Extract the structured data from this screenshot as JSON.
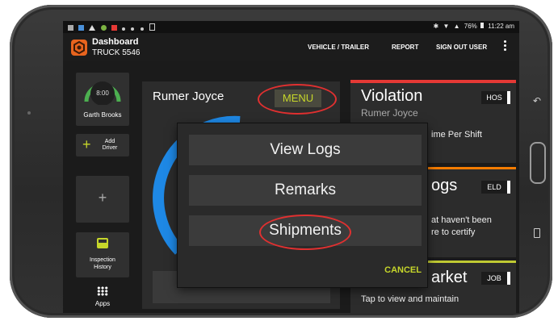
{
  "status_bar": {
    "battery": "76%",
    "time": "11:22 am"
  },
  "app_bar": {
    "title": "Dashboard",
    "subtitle": "TRUCK 5546",
    "nav": [
      "VEHICLE / TRAILER",
      "REPORT",
      "SIGN OUT USER"
    ],
    "overflow_icon": "more-vert-icon"
  },
  "sidebar": {
    "driver_time": "8:00",
    "driver_name": "Garth Brooks",
    "add_driver_label": "Add Driver",
    "plus_symbol": "+",
    "inspection_label": "Inspection History",
    "apps_label": "Apps"
  },
  "driver_card": {
    "name": "Rumer Joyce",
    "menu_label": "MENU"
  },
  "right_cards": {
    "violation": {
      "title": "Violation",
      "subtitle": "Rumer Joyce",
      "badge": "HOS",
      "partial": "ime Per Shift",
      "accent": "#e53935"
    },
    "logs": {
      "title": "ogs",
      "badge": "ELD",
      "line1": "at haven't been",
      "line2": "re to certify",
      "accent": "#f57c00"
    },
    "market": {
      "title": "arket",
      "badge": "JOB",
      "line1": "Tap to view and maintain",
      "accent": "#c0ca33"
    }
  },
  "popup_menu": {
    "items": [
      "View Logs",
      "Remarks",
      "Shipments"
    ],
    "cancel_label": "CANCEL",
    "cancel_color": "#c6d62a"
  }
}
